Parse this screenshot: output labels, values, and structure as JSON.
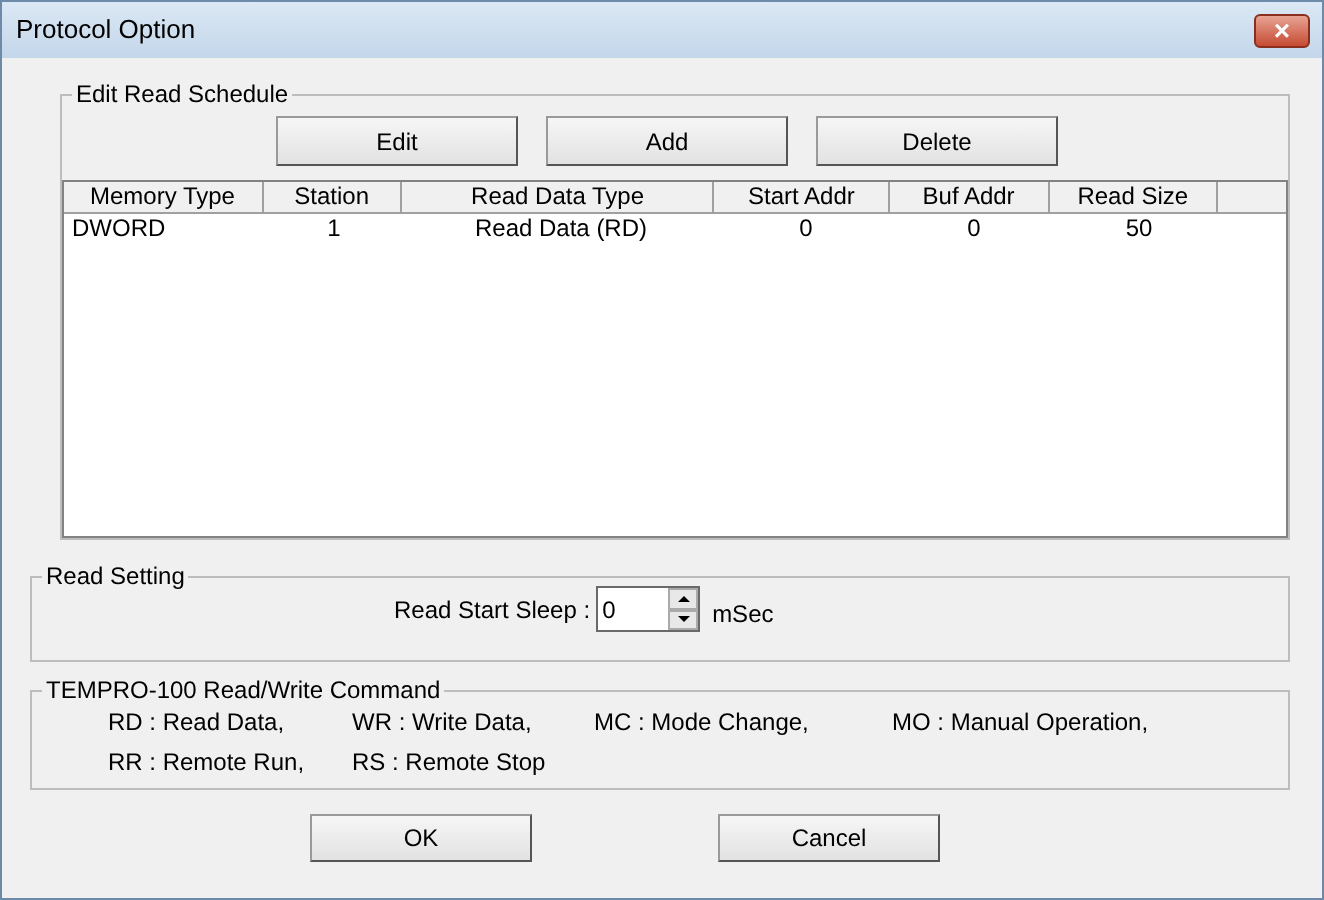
{
  "window": {
    "title": "Protocol Option",
    "close": "×"
  },
  "schedule": {
    "title": "Edit Read Schedule",
    "buttons": [
      "Edit",
      "Add",
      "Delete"
    ],
    "table": {
      "columns": [
        "Memory Type",
        "Station",
        "Read Data Type",
        "Start Addr",
        "Buf Addr",
        "Read Size"
      ],
      "rows": [
        [
          "DWORD",
          "1",
          "Read Data (RD)",
          "0",
          "0",
          "50"
        ]
      ]
    }
  },
  "read_setting": {
    "title": "Read Setting",
    "label": "Read Start Sleep :",
    "value": "0",
    "unit": "mSec"
  },
  "commands": {
    "title": "TEMPRO-100 Read/Write Command",
    "items": [
      "RD : Read Data,",
      "WR : Write Data,",
      "MC : Mode Change,",
      "MO : Manual Operation,",
      "RR : Remote Run,",
      "RS : Remote Stop"
    ]
  },
  "buttons": [
    "OK",
    "Cancel"
  ]
}
